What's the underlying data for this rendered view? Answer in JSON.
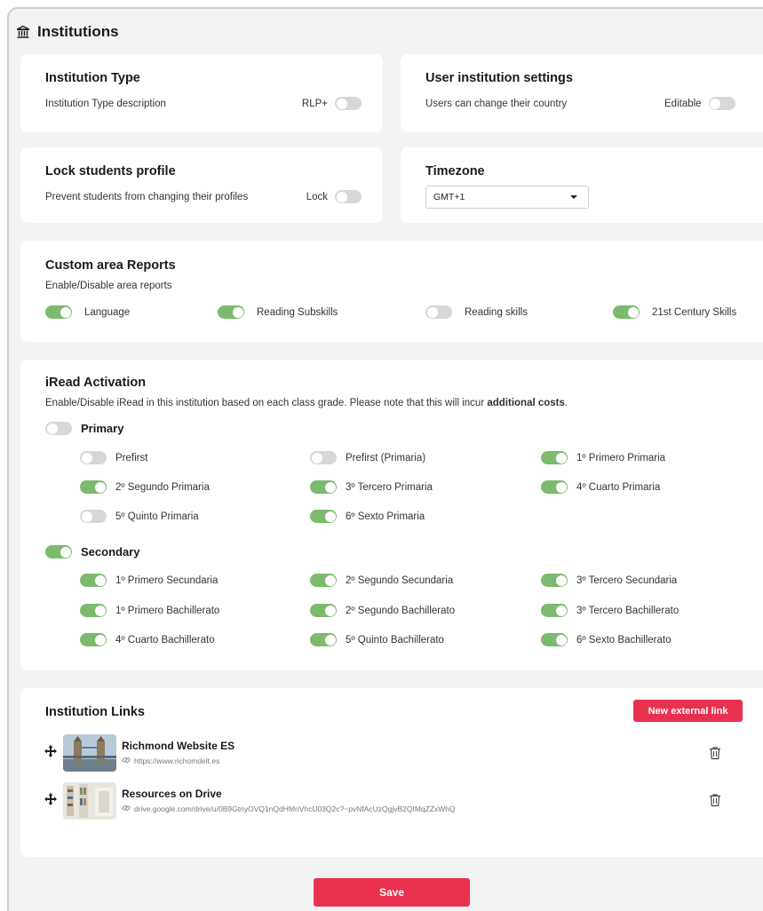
{
  "page": {
    "title": "Institutions"
  },
  "institution_type": {
    "title": "Institution Type",
    "description": "Institution Type description",
    "toggle_label": "RLP+",
    "toggle_on": false
  },
  "user_settings": {
    "title": "User institution settings",
    "description": "Users can change their country",
    "toggle_label": "Editable",
    "toggle_on": false
  },
  "lock_profile": {
    "title": "Lock students profile",
    "description": "Prevent students from changing their profiles",
    "toggle_label": "Lock",
    "toggle_on": false
  },
  "timezone": {
    "title": "Timezone",
    "selected": "GMT+1"
  },
  "area_reports": {
    "title": "Custom area Reports",
    "description": "Enable/Disable area reports",
    "items": [
      {
        "label": "Language",
        "on": true
      },
      {
        "label": "Reading Subskills",
        "on": true
      },
      {
        "label": "Reading skills",
        "on": false
      },
      {
        "label": "21st Century Skills",
        "on": true
      }
    ]
  },
  "iread": {
    "title": "iRead Activation",
    "description": "Enable/Disable iRead in this institution based on each class grade. Please note that this will incur",
    "description_bold": "additional costs",
    "description_end": ".",
    "groups": [
      {
        "label": "Primary",
        "on": false,
        "grades": [
          {
            "label": "Prefirst",
            "on": false
          },
          {
            "label": "Prefirst (Primaria)",
            "on": false
          },
          {
            "label": "1º Primero Primaria",
            "on": true
          },
          {
            "label": "2º Segundo Primaria",
            "on": true
          },
          {
            "label": "3º Tercero Primaria",
            "on": true
          },
          {
            "label": "4º Cuarto Primaria",
            "on": true
          },
          {
            "label": "5º Quinto Primaria",
            "on": false
          },
          {
            "label": "6º Sexto Primaria",
            "on": true
          }
        ]
      },
      {
        "label": "Secondary",
        "on": true,
        "grades": [
          {
            "label": "1º Primero Secundaria",
            "on": true
          },
          {
            "label": "2º Segundo Secundaria",
            "on": true
          },
          {
            "label": "3º Tercero Secundaria",
            "on": true
          },
          {
            "label": "1º Primero Bachillerato",
            "on": true
          },
          {
            "label": "2º Segundo Bachillerato",
            "on": true
          },
          {
            "label": "3º Tercero Bachillerato",
            "on": true
          },
          {
            "label": "4º Cuarto Bachillerato",
            "on": true
          },
          {
            "label": "5º Quinto Bachillerato",
            "on": true
          },
          {
            "label": "6º Sexto Bachillerato",
            "on": true
          }
        ]
      }
    ]
  },
  "links": {
    "title": "Institution Links",
    "new_button": "New external link",
    "items": [
      {
        "title": "Richmond Website ES",
        "url": "https://www.richomdelt.es",
        "thumb_icon": "bridge-photo-icon"
      },
      {
        "title": "Resources on Drive",
        "url": "drive.google.com/drive/u/0B9GtnyOVQ1nQdHMnVhcU03Q2c?~pvNfAcUzQgjvB2QIMqZZxWhQ",
        "thumb_icon": "library-photo-icon"
      }
    ]
  },
  "footer": {
    "save_label": "Save"
  },
  "colors": {
    "toggle_on": "#7db96e",
    "toggle_off": "#d7d7d7",
    "accent_red": "#e8314f"
  }
}
